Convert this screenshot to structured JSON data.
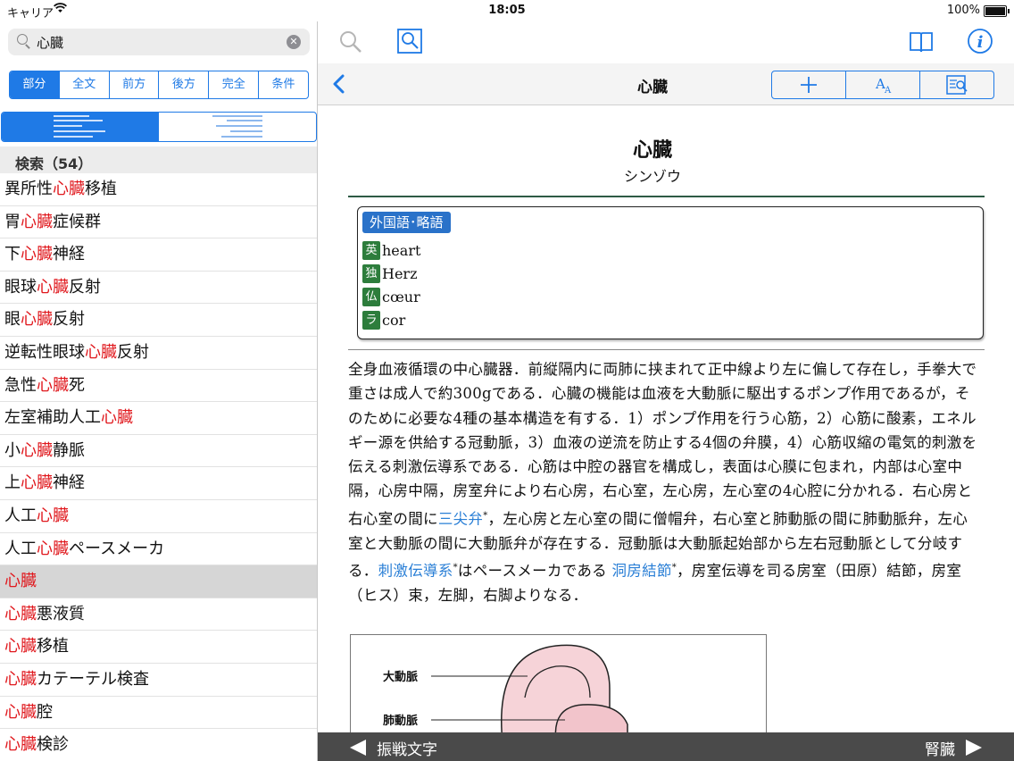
{
  "status": {
    "carrier": "キャリア",
    "time": "18:05",
    "battery": "100%"
  },
  "search": {
    "query": "心臓",
    "modes": [
      "部分",
      "全文",
      "前方",
      "後方",
      "完全",
      "条件"
    ],
    "active_mode": "部分"
  },
  "results": {
    "header": "検索（54）",
    "items": [
      {
        "pre": "異所性",
        "hl": "心臓",
        "post": "移植"
      },
      {
        "pre": "胃",
        "hl": "心臓",
        "post": "症候群"
      },
      {
        "pre": "下",
        "hl": "心臓",
        "post": "神経"
      },
      {
        "pre": "眼球",
        "hl": "心臓",
        "post": "反射"
      },
      {
        "pre": "眼",
        "hl": "心臓",
        "post": "反射"
      },
      {
        "pre": "逆転性眼球",
        "hl": "心臓",
        "post": "反射"
      },
      {
        "pre": "急性",
        "hl": "心臓",
        "post": "死"
      },
      {
        "pre": "左室補助人工",
        "hl": "心臓",
        "post": ""
      },
      {
        "pre": "小",
        "hl": "心臓",
        "post": "静脈"
      },
      {
        "pre": "上",
        "hl": "心臓",
        "post": "神経"
      },
      {
        "pre": "人工",
        "hl": "心臓",
        "post": ""
      },
      {
        "pre": "人工",
        "hl": "心臓",
        "post": "ペースメーカ"
      },
      {
        "pre": "",
        "hl": "心臓",
        "post": "",
        "selected": true
      },
      {
        "pre": "",
        "hl": "心臓",
        "post": "悪液質"
      },
      {
        "pre": "",
        "hl": "心臓",
        "post": "移植"
      },
      {
        "pre": "",
        "hl": "心臓",
        "post": "カテーテル検査"
      },
      {
        "pre": "",
        "hl": "心臓",
        "post": "腔"
      },
      {
        "pre": "",
        "hl": "心臓",
        "post": "検診"
      }
    ]
  },
  "nav": {
    "title": "心臓"
  },
  "entry": {
    "title": "心臓",
    "reading": "シンゾウ",
    "foreign_label": "外国語･略語",
    "terms": [
      {
        "lang": "英",
        "word": "heart"
      },
      {
        "lang": "独",
        "word": "Herz"
      },
      {
        "lang": "仏",
        "word": "cœur"
      },
      {
        "lang": "ラ",
        "word": "cor"
      }
    ],
    "body": {
      "p1": "全身血液循環の中心臓器．前縦隔内に両肺に挟まれて正中線より左に偏して存在し，手拳大で重さは成人で約300gである．心臓の機能は血液を大動脈に駆出するポンプ作用であるが，そのために必要な4種の基本構造を有する．1）ポンプ作用を行う心筋，2）心筋に酸素，エネルギー源を供給する冠動脈，3）血液の逆流を防止する4個の弁膜，4）心筋収縮の電気的刺激を伝える刺激伝導系である．心筋は中腔の器官を構成し，表面は心膜に包まれ，内部は心室中隔，心房中隔，房室弁により右心房，右心室，左心房，左心室の4心腔に分かれる．右心房と右心室の間に",
      "link1": "三尖弁",
      "p2": "，左心房と左心室の間に僧帽弁，右心室と肺動脈の間に肺動脈弁，左心室と大動脈の間に大動脈弁が存在する．冠動脈は大動脈起始部から左右冠動脈として分岐する．",
      "link2": "刺激伝導系",
      "p3": "はペースメーカである",
      "link3": "洞房結節",
      "p4": "，房室伝導を司る房室（田原）結節，房室（ヒス）束，左脚，右脚よりなる．",
      "star": "*"
    },
    "figure": {
      "label1": "大動脈",
      "label2": "肺動脈"
    }
  },
  "bottom": {
    "prev": "振戦文字",
    "next": "腎臓"
  },
  "colors": {
    "accent": "#1f7ae6",
    "highlight": "#e0191e",
    "lang_badge": "#2d7d3c",
    "link": "#2a7fd6"
  }
}
